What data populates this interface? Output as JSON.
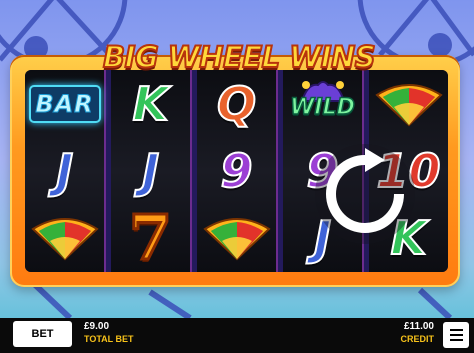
{
  "game": {
    "title": "BIG WHEEL WINS"
  },
  "reels": [
    [
      {
        "kind": "bar",
        "text": "BAR"
      },
      {
        "kind": "letter",
        "text": "J",
        "color": "#3f63d8"
      },
      {
        "kind": "fan"
      }
    ],
    [
      {
        "kind": "letter",
        "text": "K",
        "color": "#33c45a"
      },
      {
        "kind": "letter",
        "text": "J",
        "color": "#3f63d8"
      },
      {
        "kind": "seven",
        "text": "7"
      }
    ],
    [
      {
        "kind": "letter",
        "text": "Q",
        "color": "#e9622c"
      },
      {
        "kind": "letter",
        "text": "9",
        "color": "#9b3fd4"
      },
      {
        "kind": "fan"
      }
    ],
    [
      {
        "kind": "wild",
        "text": "WILD"
      },
      {
        "kind": "letter",
        "text": "9",
        "color": "#9b3fd4"
      },
      {
        "kind": "letter",
        "text": "J",
        "color": "#3f63d8"
      }
    ],
    [
      {
        "kind": "fan"
      },
      {
        "kind": "letter",
        "text": "10",
        "color": "#e03a2c"
      },
      {
        "kind": "letter",
        "text": "K",
        "color": "#33c45a"
      }
    ]
  ],
  "controls": {
    "bet_label": "BET",
    "total_bet_value": "£9.00",
    "total_bet_label": "TOTAL BET",
    "credit_value": "£11.00",
    "credit_label": "CREDIT",
    "spin_icon": "refresh-icon",
    "menu_icon": "hamburger-menu-icon"
  }
}
